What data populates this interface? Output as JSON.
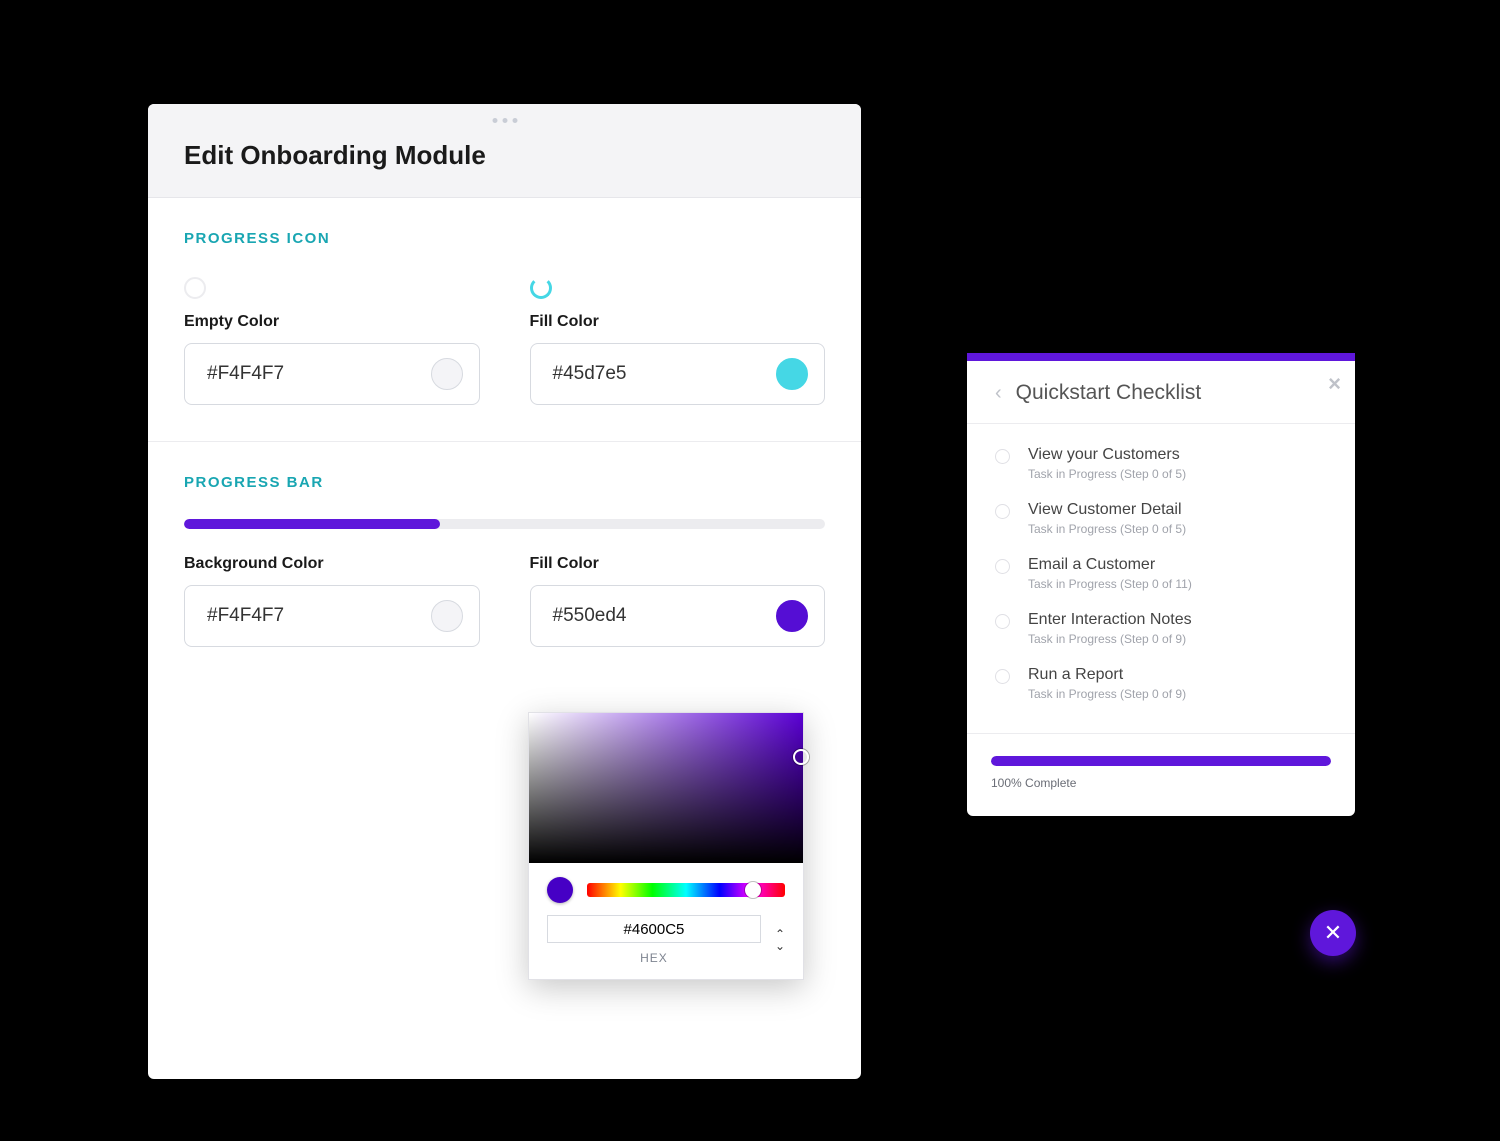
{
  "editor": {
    "title": "Edit Onboarding Module",
    "sections": {
      "progress_icon": {
        "heading": "PROGRESS ICON",
        "empty": {
          "label": "Empty Color",
          "value": "#F4F4F7",
          "swatch": "#F4F4F7"
        },
        "fill": {
          "label": "Fill Color",
          "value": "#45d7e5",
          "swatch": "#45d7e5"
        }
      },
      "progress_bar": {
        "heading": "PROGRESS BAR",
        "preview_fill_color": "#5f17db",
        "preview_fill_pct": 40,
        "background": {
          "label": "Background Color",
          "value": "#F4F4F7",
          "swatch": "#F4F4F7"
        },
        "fill": {
          "label": "Fill Color",
          "value": "#550ed4",
          "swatch": "#550ed4"
        }
      }
    }
  },
  "color_picker": {
    "current_color": "#4600C5",
    "hex_value": "#4600C5",
    "hex_label": "HEX"
  },
  "checklist": {
    "accent": "#5f17db",
    "title": "Quickstart Checklist",
    "items": [
      {
        "title": "View your Customers",
        "sub": "Task in Progress (Step 0 of 5)"
      },
      {
        "title": "View Customer Detail",
        "sub": "Task in Progress (Step 0 of 5)"
      },
      {
        "title": "Email a Customer",
        "sub": "Task in Progress (Step 0 of 11)"
      },
      {
        "title": "Enter Interaction Notes",
        "sub": "Task in Progress (Step 0 of 9)"
      },
      {
        "title": "Run a Report",
        "sub": "Task in Progress (Step 0 of 9)"
      }
    ],
    "progress_label": "100% Complete",
    "progress_pct": 100
  }
}
